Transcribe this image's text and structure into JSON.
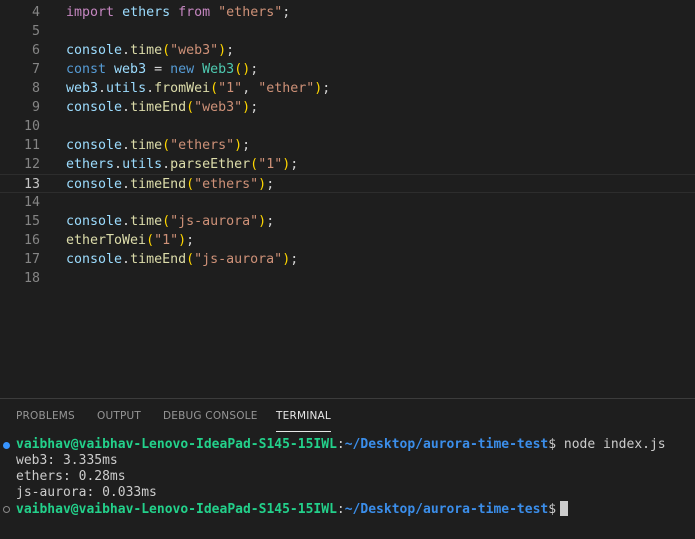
{
  "editor": {
    "lines": [
      {
        "n": "4",
        "t": [
          [
            "kw",
            "import"
          ],
          [
            "plain",
            " "
          ],
          [
            "var",
            "ethers"
          ],
          [
            "plain",
            " "
          ],
          [
            "kw",
            "from"
          ],
          [
            "plain",
            " "
          ],
          [
            "str",
            "\"ethers\""
          ],
          [
            "plain",
            ";"
          ]
        ]
      },
      {
        "n": "5",
        "t": []
      },
      {
        "n": "6",
        "t": [
          [
            "var",
            "console"
          ],
          [
            "plain",
            "."
          ],
          [
            "fn",
            "time"
          ],
          [
            "p1",
            "("
          ],
          [
            "str",
            "\"web3\""
          ],
          [
            "p1",
            ")"
          ],
          [
            "plain",
            ";"
          ]
        ]
      },
      {
        "n": "7",
        "t": [
          [
            "kb",
            "const"
          ],
          [
            "plain",
            " "
          ],
          [
            "var",
            "web3"
          ],
          [
            "plain",
            " = "
          ],
          [
            "kb",
            "new"
          ],
          [
            "plain",
            " "
          ],
          [
            "cls",
            "Web3"
          ],
          [
            "p1",
            "()"
          ],
          [
            "plain",
            ";"
          ]
        ]
      },
      {
        "n": "8",
        "t": [
          [
            "var",
            "web3"
          ],
          [
            "plain",
            "."
          ],
          [
            "var",
            "utils"
          ],
          [
            "plain",
            "."
          ],
          [
            "fn",
            "fromWei"
          ],
          [
            "p1",
            "("
          ],
          [
            "str",
            "\"1\""
          ],
          [
            "plain",
            ", "
          ],
          [
            "str",
            "\"ether\""
          ],
          [
            "p1",
            ")"
          ],
          [
            "plain",
            ";"
          ]
        ]
      },
      {
        "n": "9",
        "t": [
          [
            "var",
            "console"
          ],
          [
            "plain",
            "."
          ],
          [
            "fn",
            "timeEnd"
          ],
          [
            "p1",
            "("
          ],
          [
            "str",
            "\"web3\""
          ],
          [
            "p1",
            ")"
          ],
          [
            "plain",
            ";"
          ]
        ]
      },
      {
        "n": "10",
        "t": []
      },
      {
        "n": "11",
        "t": [
          [
            "var",
            "console"
          ],
          [
            "plain",
            "."
          ],
          [
            "fn",
            "time"
          ],
          [
            "p1",
            "("
          ],
          [
            "str",
            "\"ethers\""
          ],
          [
            "p1",
            ")"
          ],
          [
            "plain",
            ";"
          ]
        ]
      },
      {
        "n": "12",
        "t": [
          [
            "var",
            "ethers"
          ],
          [
            "plain",
            "."
          ],
          [
            "var",
            "utils"
          ],
          [
            "plain",
            "."
          ],
          [
            "fn",
            "parseEther"
          ],
          [
            "p1",
            "("
          ],
          [
            "str",
            "\"1\""
          ],
          [
            "p1",
            ")"
          ],
          [
            "plain",
            ";"
          ]
        ]
      },
      {
        "n": "13",
        "t": [
          [
            "var",
            "console"
          ],
          [
            "plain",
            "."
          ],
          [
            "fn",
            "timeEnd"
          ],
          [
            "p1",
            "("
          ],
          [
            "str",
            "\"ethers\""
          ],
          [
            "p1",
            ")"
          ],
          [
            "plain",
            ";"
          ]
        ],
        "current": true
      },
      {
        "n": "14",
        "t": []
      },
      {
        "n": "15",
        "t": [
          [
            "var",
            "console"
          ],
          [
            "plain",
            "."
          ],
          [
            "fn",
            "time"
          ],
          [
            "p1",
            "("
          ],
          [
            "str",
            "\"js-aurora\""
          ],
          [
            "p1",
            ")"
          ],
          [
            "plain",
            ";"
          ]
        ]
      },
      {
        "n": "16",
        "t": [
          [
            "fn",
            "etherToWei"
          ],
          [
            "p1",
            "("
          ],
          [
            "str",
            "\"1\""
          ],
          [
            "p1",
            ")"
          ],
          [
            "plain",
            ";"
          ]
        ]
      },
      {
        "n": "17",
        "t": [
          [
            "var",
            "console"
          ],
          [
            "plain",
            "."
          ],
          [
            "fn",
            "timeEnd"
          ],
          [
            "p1",
            "("
          ],
          [
            "str",
            "\"js-aurora\""
          ],
          [
            "p1",
            ")"
          ],
          [
            "plain",
            ";"
          ]
        ]
      },
      {
        "n": "18",
        "t": []
      }
    ]
  },
  "panel": {
    "tabs": [
      "PROBLEMS",
      "OUTPUT",
      "DEBUG CONSOLE",
      "TERMINAL"
    ],
    "active_tab": "TERMINAL"
  },
  "terminal": {
    "user_host": "vaibhav@vaibhav-Lenovo-IdeaPad-S145-15IWL",
    "sep": ":",
    "path": "~/Desktop/aurora-time-test",
    "prompt_symbol": "$",
    "command": " node index.js",
    "outputs": [
      "web3: 3.335ms",
      "ethers: 0.28ms",
      "js-aurora: 0.033ms"
    ]
  },
  "colors": {
    "background": "#1e1e1e",
    "user_green": "#23d18b",
    "path_blue": "#3b8eea",
    "status_dot_blue": "#3794ff"
  }
}
